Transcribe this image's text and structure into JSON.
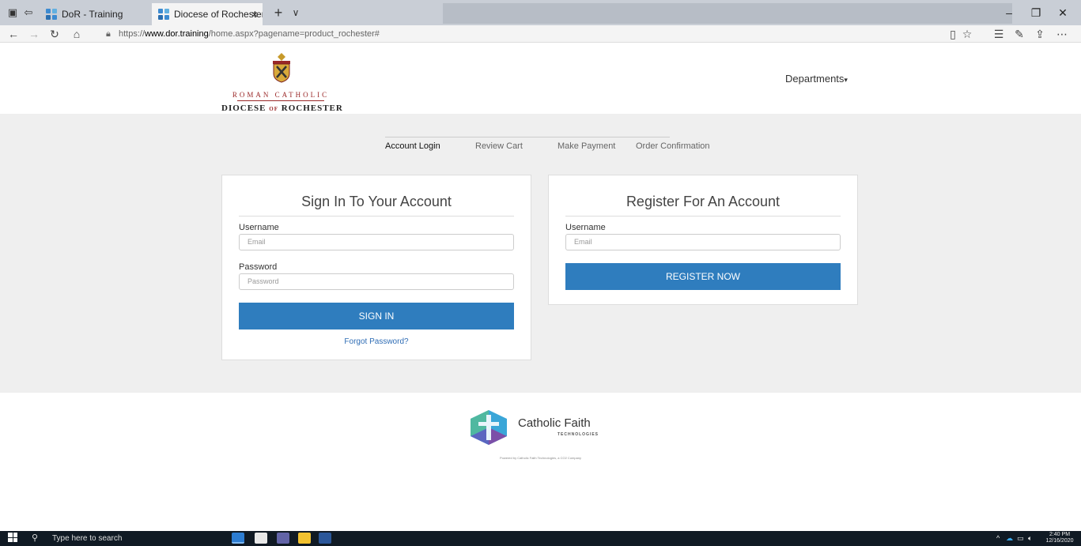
{
  "browser": {
    "tabs": [
      {
        "label": "DoR - Training"
      },
      {
        "label": "Diocese of Rochester - I",
        "close": "×"
      }
    ],
    "new_tab": "+",
    "tab_dropdown": "∨",
    "window_controls": {
      "minimize": "–",
      "restore": "❐",
      "close": "✕"
    },
    "url_prefix": "https://",
    "url_domain": "www.dor.training",
    "url_rest": "/home.aspx?pagename=product_rochester#"
  },
  "header": {
    "logo": {
      "line1": "ROMAN CATHOLIC",
      "line2_a": "DIOCESE",
      "line2_of": "OF",
      "line2_b": "ROCHESTER"
    },
    "departments_label": "Departments",
    "departments_caret": "▾"
  },
  "steps": [
    {
      "label": "Account Login",
      "active": true
    },
    {
      "label": "Review Cart",
      "active": false
    },
    {
      "label": "Make Payment",
      "active": false
    },
    {
      "label": "Order Confirmation",
      "active": false
    }
  ],
  "signin": {
    "title": "Sign In To Your Account",
    "username_label": "Username",
    "username_placeholder": "Email",
    "password_label": "Password",
    "password_placeholder": "Password",
    "button_label": "SIGN IN",
    "forgot_label": "Forgot Password?"
  },
  "register": {
    "title": "Register For An Account",
    "username_label": "Username",
    "username_placeholder": "Email",
    "button_label": "REGISTER NOW"
  },
  "footer": {
    "brand_name": "Catholic Faith",
    "brand_sub": "TECHNOLOGIES",
    "powered_by": "Powered by Catholic Faith Technologies, a CO2 Company"
  },
  "taskbar": {
    "search_placeholder": "Type here to search",
    "time": "2:40 PM",
    "date": "12/16/2020"
  },
  "colors": {
    "primary_button": "#2f7dbe",
    "link": "#2f6db5",
    "brand_red": "#9a2727",
    "page_bg": "#efefef"
  }
}
